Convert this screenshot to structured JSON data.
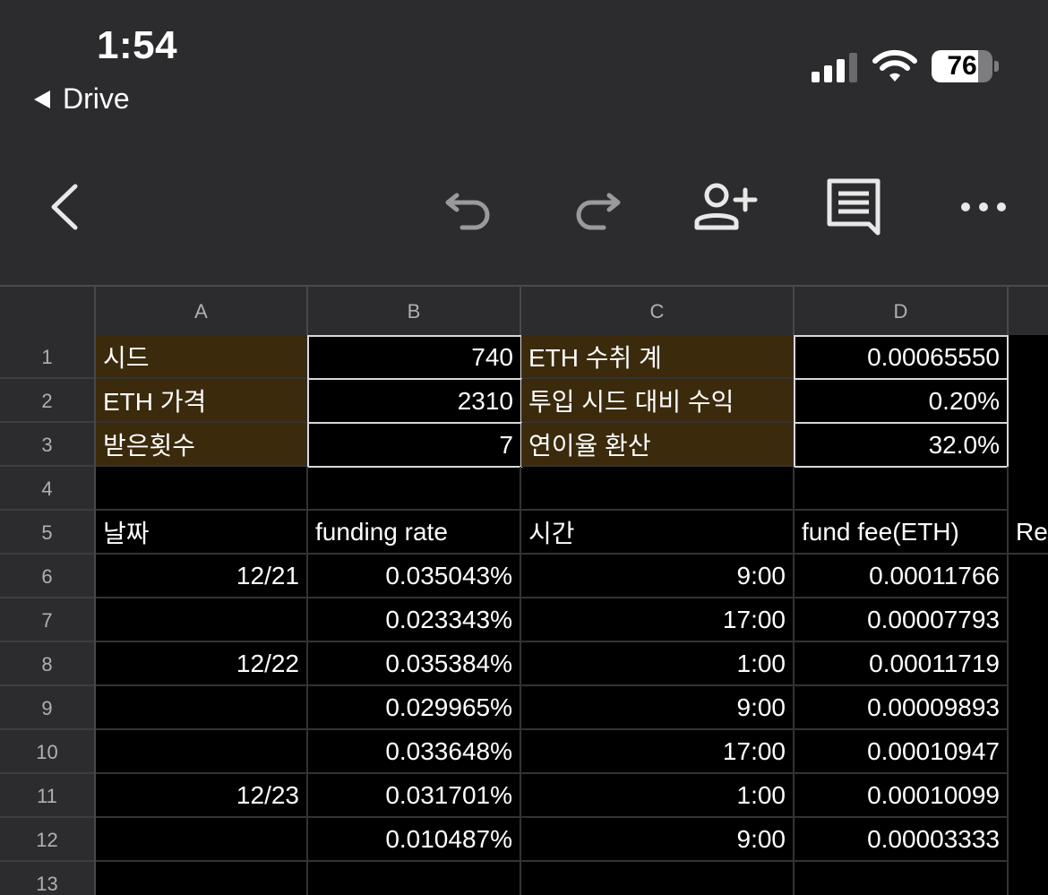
{
  "status": {
    "time": "1:54",
    "back_label": "Drive",
    "battery": "76",
    "battery_level": 0.76
  },
  "toolbar": {
    "icons": [
      "chevron-left-icon",
      "undo-icon",
      "redo-icon",
      "add-person-icon",
      "comment-icon",
      "more-icon"
    ]
  },
  "sheet": {
    "columns": [
      "A",
      "B",
      "C",
      "D"
    ],
    "rows": [
      "1",
      "2",
      "3",
      "4",
      "5",
      "6",
      "7",
      "8",
      "9",
      "10",
      "11",
      "12",
      "13"
    ],
    "summary": [
      {
        "label1": "시드",
        "value1": "740",
        "label2": "ETH 수취 계",
        "value2": "0.00065550"
      },
      {
        "label1": "ETH 가격",
        "value1": "2310",
        "label2": "투입 시드 대비 수익",
        "value2": "0.20%"
      },
      {
        "label1": "받은횟수",
        "value1": "7",
        "label2": "연이율 환산",
        "value2": "32.0%"
      }
    ],
    "headers": [
      "날짜",
      "funding rate",
      "시간",
      "fund fee(ETH)",
      "Re"
    ],
    "data": [
      {
        "date": "12/21",
        "rate": "0.035043%",
        "time": "9:00",
        "fee": "0.00011766"
      },
      {
        "date": "",
        "rate": "0.023343%",
        "time": "17:00",
        "fee": "0.00007793"
      },
      {
        "date": "12/22",
        "rate": "0.035384%",
        "time": "1:00",
        "fee": "0.00011719"
      },
      {
        "date": "",
        "rate": "0.029965%",
        "time": "9:00",
        "fee": "0.00009893"
      },
      {
        "date": "",
        "rate": "0.033648%",
        "time": "17:00",
        "fee": "0.00010947"
      },
      {
        "date": "12/23",
        "rate": "0.031701%",
        "time": "1:00",
        "fee": "0.00010099"
      },
      {
        "date": "",
        "rate": "0.010487%",
        "time": "9:00",
        "fee": "0.00003333"
      }
    ]
  },
  "colors": {
    "background": "#2c2c2e",
    "sheet_bg": "#000000",
    "label_fill": "#3b2a0c",
    "header_text": "#b0b0b4"
  }
}
